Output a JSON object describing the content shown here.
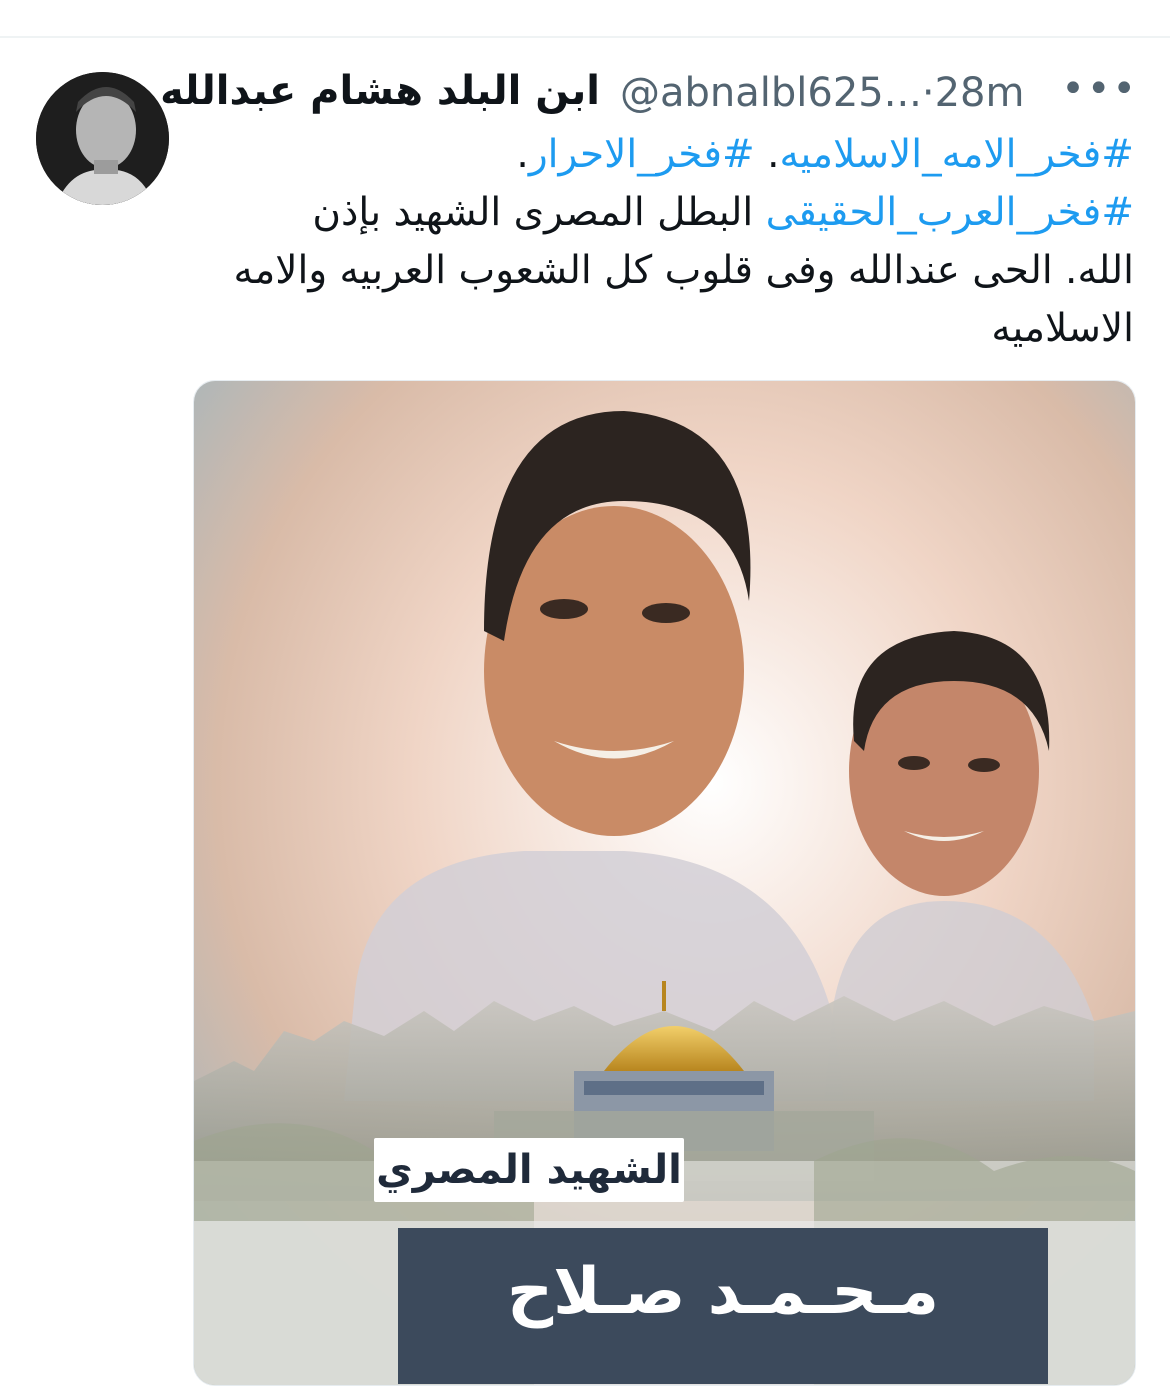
{
  "tweet": {
    "author_name": "ابن البلد هشام عبدالله",
    "handle": "@abnalbl625...",
    "separator": "·",
    "time": "28m",
    "more_label": "•••",
    "lines": [
      {
        "parts": [
          {
            "text": "#فخر_الامه_الاسلاميه",
            "tag": true
          },
          {
            "text": ". ",
            "tag": false
          },
          {
            "text": "#فخر_الاحرار",
            "tag": true
          },
          {
            "text": ".",
            "tag": false
          }
        ]
      },
      {
        "parts": [
          {
            "text": "#فخر_العرب_الحقيقى",
            "tag": true
          },
          {
            "text": "  البطل المصرى الشهيد بإذن",
            "tag": false
          }
        ]
      },
      {
        "parts": [
          {
            "text": "الله.  الحى عندالله وفى قلوب كل الشعوب العربيه والامه",
            "tag": false
          }
        ]
      },
      {
        "parts": [
          {
            "text": "الاسلاميه",
            "tag": false
          }
        ]
      }
    ]
  },
  "media": {
    "caption_subtitle": "الشهيد المصري",
    "caption_name": "مـحـمـد صـلاح",
    "colors": {
      "sky_top": "#b9c3c7",
      "peach": "#e9c0ad",
      "dome_gold": "#d9a93a",
      "caption_bar": "#3c4a5c"
    }
  }
}
